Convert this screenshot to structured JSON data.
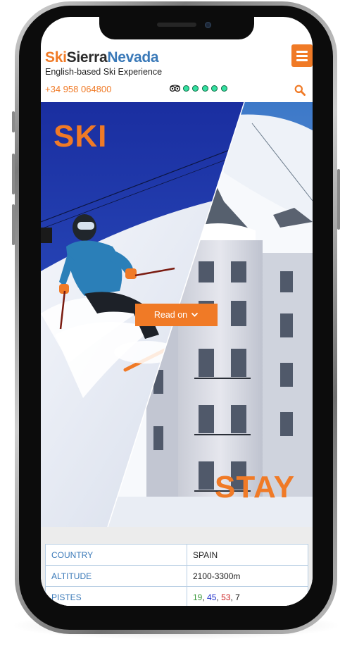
{
  "header": {
    "logo": {
      "ski": "Ski",
      "sierra": "Sierra",
      "nevada": "Nevada"
    },
    "tagline": "English-based Ski Experience",
    "phone": "+34 958 064800",
    "menu_icon": "hamburger-icon",
    "search_icon": "search-icon",
    "rating": {
      "icon": "tripadvisor-owl-icon",
      "score": 5,
      "max": 5
    }
  },
  "hero": {
    "left_label": "SKI",
    "right_label": "STAY",
    "button": {
      "label": "Read on",
      "icon": "chevron-down-icon"
    }
  },
  "info_table": {
    "rows": [
      {
        "key": "COUNTRY",
        "value": "SPAIN"
      },
      {
        "key": "ALTITUDE",
        "value": "2100-3300m"
      }
    ],
    "pistes": {
      "key": "PISTES",
      "green": "19",
      "blue": "45",
      "red": "53",
      "black": "7",
      "sep": ", "
    }
  },
  "colors": {
    "accent": "#f07a26",
    "link_blue": "#3a79b8",
    "dark": "#2b2b2b",
    "rating_green": "#34e0a1"
  }
}
